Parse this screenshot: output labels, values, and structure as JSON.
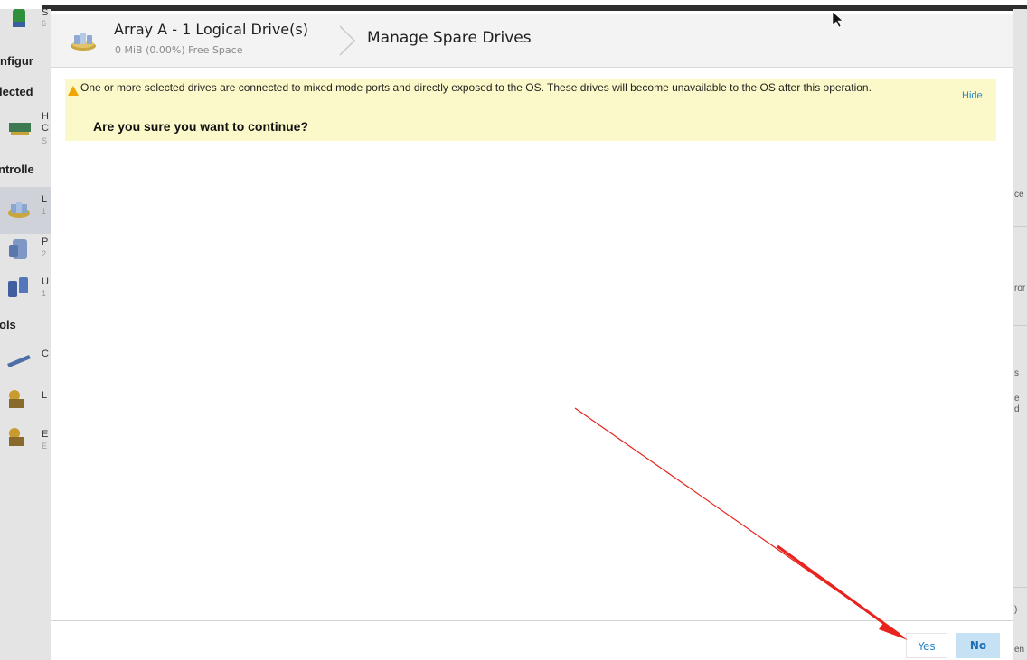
{
  "background_app": {
    "headings": [
      "nfigur",
      "lected",
      "ntrolle",
      "ols"
    ],
    "items": [
      {
        "line1": "S",
        "line2": "6"
      },
      {
        "line1": "H",
        "line2": "C",
        "line3": "S"
      },
      {
        "line1": "L",
        "line2": "1"
      },
      {
        "line1": "P",
        "line2": "2"
      },
      {
        "line1": "U",
        "line2": "1"
      },
      {
        "line1": "C"
      },
      {
        "line1": "L"
      },
      {
        "line1": "E",
        "line2": "E"
      }
    ],
    "right_fragments": [
      "ce",
      "ror",
      "s",
      "e",
      "d",
      ")",
      "en"
    ]
  },
  "dialog": {
    "array_title": "Array A - 1 Logical Drive(s)",
    "array_subtitle": "0 MiB (0.00%) Free Space",
    "page_title": "Manage Spare Drives",
    "warning": {
      "message": "One or more selected drives are connected to mixed mode ports and directly exposed to the OS. These drives will become unavailable to the OS after this operation.",
      "question": "Are you sure you want to continue?",
      "hide_label": "Hide"
    },
    "buttons": {
      "yes_label": "Yes",
      "no_label": "No"
    }
  },
  "colors": {
    "warning_bg": "#fbf9c9",
    "warning_icon": "#f0a500",
    "link_blue": "#2a86c9",
    "primary_button_bg": "#c6e1f3",
    "annotation_arrow": "#e8231d"
  },
  "icons": {
    "array": "array-drives-icon",
    "breadcrumb": "chevron-right-icon",
    "warning": "warning-triangle-icon",
    "cursor": "mouse-cursor-icon",
    "annotation": "red-arrow-annotation"
  }
}
